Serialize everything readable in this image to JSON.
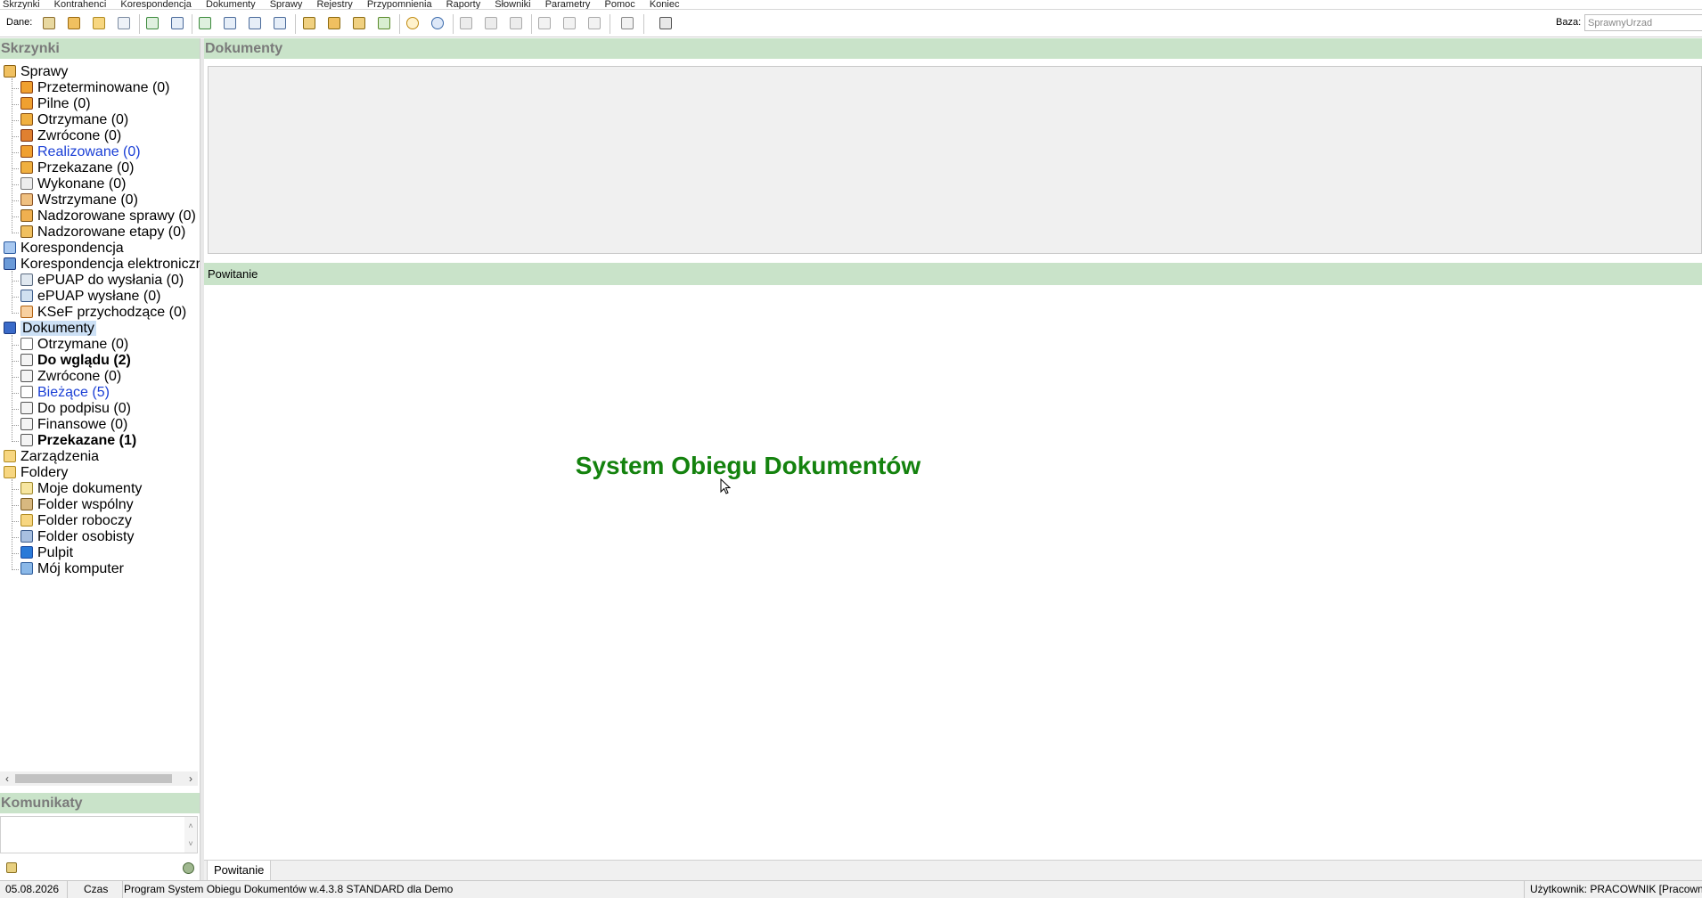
{
  "menubar": {
    "items": [
      "Skrzynki",
      "Kontrahenci",
      "Korespondencja",
      "Dokumenty",
      "Sprawy",
      "Rejestry",
      "Przypomnienia",
      "Raporty",
      "Słowniki",
      "Parametry",
      "Pomoc",
      "Koniec"
    ]
  },
  "toolbar": {
    "data_label": "Dane:",
    "db_label": "Baza:",
    "db_value": "SprawnyUrzad"
  },
  "left": {
    "header": "Skrzynki",
    "tree": [
      {
        "label": "Sprawy",
        "icon": "folder-cases-icon"
      },
      {
        "label": "Przeterminowane (0)",
        "icon": "overdue-icon"
      },
      {
        "label": "Pilne (0)",
        "icon": "urgent-icon"
      },
      {
        "label": "Otrzymane (0)",
        "icon": "received-icon"
      },
      {
        "label": "Zwrócone (0)",
        "icon": "returned-icon"
      },
      {
        "label": "Realizowane (0)",
        "icon": "in-progress-icon"
      },
      {
        "label": "Przekazane (0)",
        "icon": "forwarded-icon"
      },
      {
        "label": "Wykonane (0)",
        "icon": "done-icon"
      },
      {
        "label": "Wstrzymane (0)",
        "icon": "paused-icon"
      },
      {
        "label": "Nadzorowane sprawy (0)",
        "icon": "supervised-cases-icon"
      },
      {
        "label": "Nadzorowane etapy (0)",
        "icon": "supervised-stages-icon"
      },
      {
        "label": "Korespondencja",
        "icon": "correspondence-icon"
      },
      {
        "label": "Korespondencja elektroniczr",
        "icon": "e-correspondence-icon"
      },
      {
        "label": "ePUAP do wysłania (0)",
        "icon": "epuap-outbox-icon"
      },
      {
        "label": "ePUAP wysłane (0)",
        "icon": "epuap-sent-icon"
      },
      {
        "label": "KSeF przychodzące (0)",
        "icon": "ksef-incoming-icon"
      },
      {
        "label": "Dokumenty",
        "icon": "documents-icon"
      },
      {
        "label": "Otrzymane (0)",
        "icon": "doc-received-icon"
      },
      {
        "label": "Do wglądu (2)",
        "icon": "doc-review-icon"
      },
      {
        "label": "Zwrócone (0)",
        "icon": "doc-returned-icon"
      },
      {
        "label": "Bieżące (5)",
        "icon": "doc-current-icon"
      },
      {
        "label": "Do podpisu (0)",
        "icon": "doc-sign-icon"
      },
      {
        "label": "Finansowe (0)",
        "icon": "doc-finance-icon"
      },
      {
        "label": "Przekazane (1)",
        "icon": "doc-forwarded-icon"
      },
      {
        "label": "Zarządzenia",
        "icon": "orders-folder-icon"
      },
      {
        "label": "Foldery",
        "icon": "folders-icon"
      },
      {
        "label": "Moje dokumenty",
        "icon": "my-documents-icon"
      },
      {
        "label": "Folder wspólny",
        "icon": "shared-folder-icon"
      },
      {
        "label": "Folder roboczy",
        "icon": "work-folder-icon"
      },
      {
        "label": "Folder osobisty",
        "icon": "personal-folder-icon"
      },
      {
        "label": "Pulpit",
        "icon": "desktop-icon"
      },
      {
        "label": "Mój komputer",
        "icon": "computer-icon"
      }
    ],
    "messages_header": "Komunikaty"
  },
  "right": {
    "docs_header": "Dokumenty",
    "welcome_header": "Powitanie",
    "welcome_title": "System Obiegu Dokumentów",
    "tab_label": "Powitanie"
  },
  "status": {
    "date": "05.08.2026",
    "time_label": "Czas",
    "program": "Program System Obiegu Dokumentów w.4.3.8 STANDARD dla Demo",
    "user": "Użytkownik: PRACOWNIK [Pracowni"
  }
}
